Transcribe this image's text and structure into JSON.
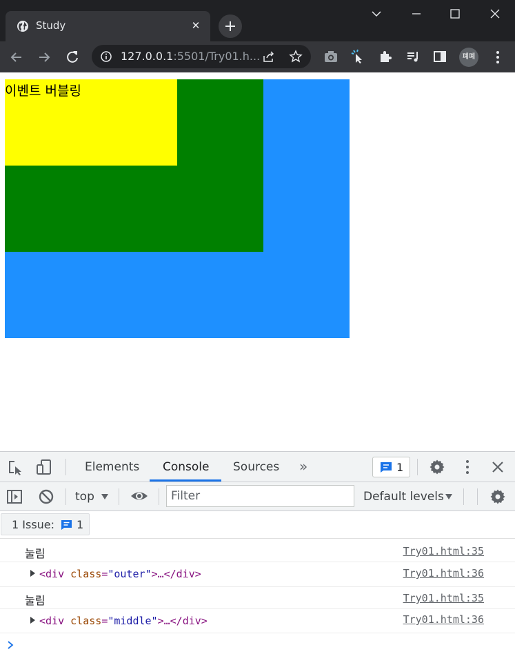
{
  "browser": {
    "tab_title": "Study",
    "tab_close": "✕",
    "url_host": "127.0.0.1",
    "url_rest": ":5501/Try01.h...",
    "profile_label": "폐폐"
  },
  "page": {
    "inner_text": "이벤트 버블링",
    "colors": {
      "outer": "#1e90ff",
      "middle": "#008000",
      "inner": "#ffff00"
    }
  },
  "devtools": {
    "tabs": [
      {
        "label": "Elements"
      },
      {
        "label": "Console"
      },
      {
        "label": "Sources"
      }
    ],
    "more_tabs": "»",
    "issue_chip_count": "1",
    "context": "top",
    "filter_placeholder": "Filter",
    "levels": "Default levels",
    "issues_label": "1 Issue:",
    "issues_count": "1",
    "logs": [
      {
        "text": "눌림",
        "source": "Try01.html:35"
      },
      {
        "tag_open": "<div",
        "attr": "class",
        "eq": "=",
        "value": "\"outer\"",
        "rest": ">…</div>",
        "source": "Try01.html:36"
      },
      {
        "text": "눌림",
        "source": "Try01.html:35"
      },
      {
        "tag_open": "<div",
        "attr": "class",
        "eq": "=",
        "value": "\"middle\"",
        "rest": ">…</div>",
        "source": "Try01.html:36"
      }
    ]
  }
}
